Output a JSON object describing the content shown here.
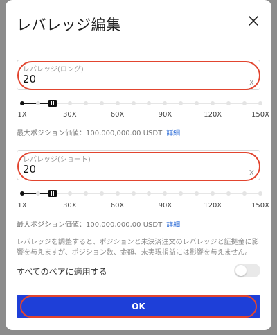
{
  "modal": {
    "title": "レバレッジ編集",
    "close_icon": "close-icon"
  },
  "long": {
    "label": "レバレッジ(ロング)",
    "value": "20",
    "unit": "X",
    "slider_ticks": [
      "1X",
      "30X",
      "60X",
      "90X",
      "120X",
      "150X"
    ],
    "slider_value": 20,
    "slider_min": 1,
    "slider_max": 150,
    "max_position_label": "最大ポジション価値：100,000,000.00 USDT",
    "details_link": "詳細"
  },
  "short": {
    "label": "レバレッジ(ショート)",
    "value": "20",
    "unit": "X",
    "slider_ticks": [
      "1X",
      "30X",
      "60X",
      "90X",
      "120X",
      "150X"
    ],
    "slider_value": 20,
    "slider_min": 1,
    "slider_max": 150,
    "max_position_label": "最大ポジション価値：100,000,000.00 USDT",
    "details_link": "詳細"
  },
  "note": "レバレッジを調整すると、ポジションと未決済注文のレバレッジと証拠金に影響を与えますが、ポジション数、金額、未実現損益には影響を与えません。",
  "apply_all": {
    "label": "すべてのペアに適用する",
    "enabled": false
  },
  "ok_button": "OK",
  "colors": {
    "accent": "#1e3fd8",
    "highlight": "#e2452f",
    "link": "#2f6ed8"
  }
}
